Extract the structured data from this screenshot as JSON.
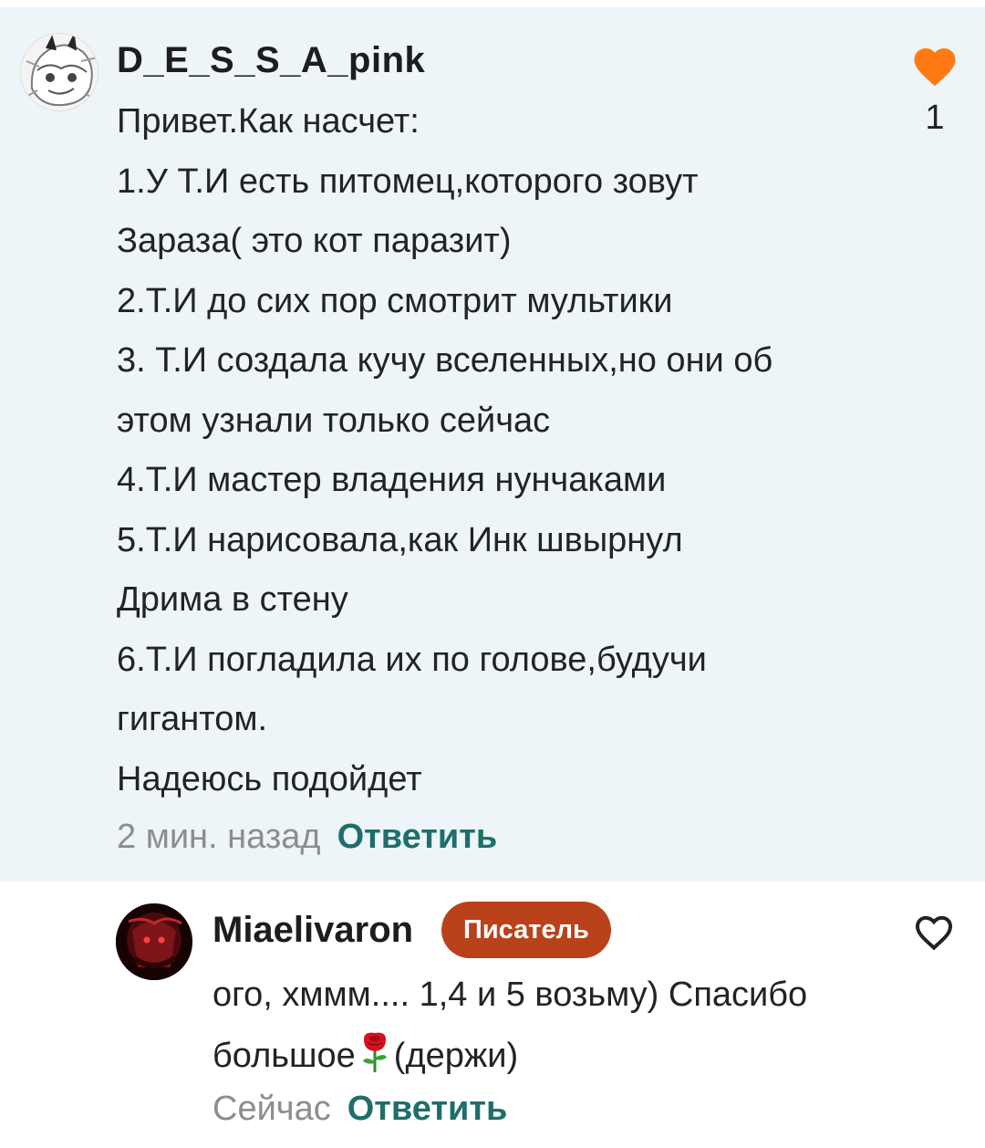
{
  "comments": [
    {
      "username": "D_E_S_S_A_pink",
      "lines": [
        "Привет.Как насчет:",
        "1.У Т.И есть питомец,которого зовут",
        "Зараза( это кот паразит)",
        "2.Т.И до сих пор смотрит мультики",
        "3. Т.И создала кучу вселенных,но они об",
        "этом узнали только сейчас",
        "4.Т.И мастер владения нунчаками",
        "5.Т.И нарисовала,как Инк швырнул",
        "Дрима в стену",
        "6.Т.И погладила их по голове,будучи",
        "гигантом.",
        "Надеюсь подойдет"
      ],
      "time": "2 мин. назад",
      "reply_label": "Ответить",
      "like_count": "1",
      "liked": true
    },
    {
      "username": "Miaelivaron",
      "badge": "Писатель",
      "line1": "ого, хммм.... 1,4 и 5 возьму) Спасибо",
      "line2_before": "большое",
      "line2_after": "(держи)",
      "emoji_icon": "rose-icon",
      "time": "Сейчас",
      "reply_label": "Ответить",
      "liked": false
    }
  ],
  "colors": {
    "highlight_bg": "#edf5f9",
    "heart": "#ff7a12",
    "reply": "#1f6e6a",
    "badge": "#b9421a"
  }
}
